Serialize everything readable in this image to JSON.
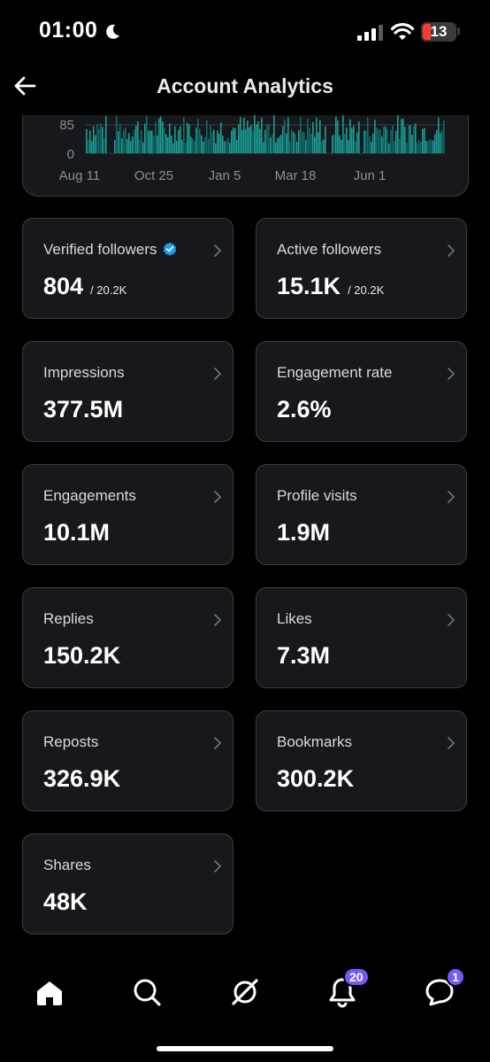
{
  "status_bar": {
    "time": "01:00",
    "battery_level": "13",
    "icons": [
      "moon-icon",
      "signal-icon",
      "wifi-icon",
      "battery-icon"
    ]
  },
  "header": {
    "title": "Account Analytics",
    "back_icon": "arrow-left-icon"
  },
  "chart_data": {
    "type": "bar",
    "visible_y_ticks": [
      "85",
      "0"
    ],
    "x_ticks": [
      "Aug 11",
      "Oct 25",
      "Jan 5",
      "Mar 18",
      "Jun 1"
    ],
    "colors": {
      "bars": "#1a9e94",
      "bars_dark": "#0f6b66",
      "grid": "#3a3c40"
    }
  },
  "metrics": [
    {
      "label": "Verified followers",
      "value": "804",
      "total": "/ 20.2K",
      "verified": true
    },
    {
      "label": "Active followers",
      "value": "15.1K",
      "total": "/ 20.2K"
    },
    {
      "label": "Impressions",
      "value": "377.5M"
    },
    {
      "label": "Engagement rate",
      "value": "2.6%"
    },
    {
      "label": "Engagements",
      "value": "10.1M"
    },
    {
      "label": "Profile visits",
      "value": "1.9M"
    },
    {
      "label": "Replies",
      "value": "150.2K"
    },
    {
      "label": "Likes",
      "value": "7.3M"
    },
    {
      "label": "Reposts",
      "value": "326.9K"
    },
    {
      "label": "Bookmarks",
      "value": "300.2K"
    },
    {
      "label": "Shares",
      "value": "48K"
    }
  ],
  "bottom_nav": {
    "items": [
      {
        "name": "home",
        "icon": "home-icon"
      },
      {
        "name": "search",
        "icon": "search-icon"
      },
      {
        "name": "grok",
        "icon": "grok-icon"
      },
      {
        "name": "notifications",
        "icon": "bell-icon",
        "badge": "20"
      },
      {
        "name": "messages",
        "icon": "messages-icon",
        "badge": "1"
      }
    ]
  },
  "colors": {
    "background": "#000000",
    "card": "#16181c",
    "border": "#3a3c40",
    "verified": "#1d9bf0",
    "badge": "#7856ff",
    "battery_low": "#ff3b30"
  }
}
